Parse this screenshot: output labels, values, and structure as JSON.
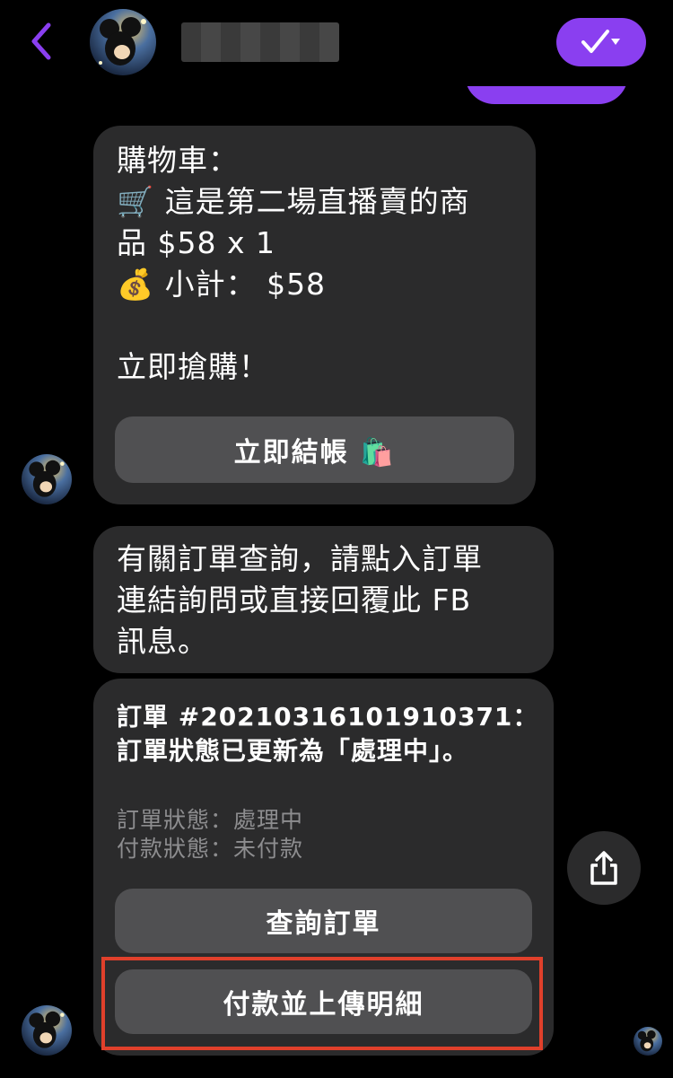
{
  "header": {
    "back_icon": "chevron-left-icon",
    "contact_name": "",
    "action_icon": "check-dropdown-icon",
    "accent_color": "#8a3ff0"
  },
  "messages": [
    {
      "lines": [
        "購物車：",
        "🛒 這是第二場直播賣的商",
        "品 $58 x 1",
        "💰 小計： $58",
        "",
        "立即搶購！"
      ],
      "button_label": "立即結帳 🛍️"
    },
    {
      "lines": [
        "有關訂單查詢，請點入訂單",
        "連結詢問或直接回覆此 FB",
        "訊息。"
      ]
    },
    {
      "title_lines": [
        "訂單 #20210316101910371：",
        "訂單狀態已更新為「處理中」。"
      ],
      "detail_lines": [
        "訂單狀態：處理中",
        "付款狀態：未付款"
      ],
      "buttons": [
        "查詢訂單",
        "付款並上傳明細"
      ]
    }
  ],
  "share_icon": "share-icon",
  "highlight_color": "#e0402b"
}
